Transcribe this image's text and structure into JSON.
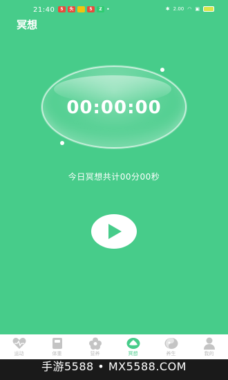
{
  "status_bar": {
    "time": "21:40",
    "notifications": [
      "5",
      "头",
      "",
      "5",
      "Z"
    ],
    "network_speed": "2.00",
    "battery": "battery"
  },
  "header": {
    "title": "冥想"
  },
  "timer": {
    "display": "00:00:00"
  },
  "summary": {
    "text": "今日冥想共计00分00秒"
  },
  "controls": {
    "play_icon": "play-icon"
  },
  "tabs": [
    {
      "label": "运动",
      "icon": "heart-icon",
      "active": false
    },
    {
      "label": "体重",
      "icon": "scale-icon",
      "active": false
    },
    {
      "label": "营养",
      "icon": "flower-icon",
      "active": false
    },
    {
      "label": "冥想",
      "icon": "lotus-icon",
      "active": true
    },
    {
      "label": "养生",
      "icon": "yin-yang-icon",
      "active": false
    },
    {
      "label": "我的",
      "icon": "person-icon",
      "active": false
    }
  ],
  "watermark": {
    "text": "手游5588 • MX5588.COM"
  },
  "colors": {
    "primary": "#47cc8a",
    "tab_inactive": "#b9b9b9"
  }
}
